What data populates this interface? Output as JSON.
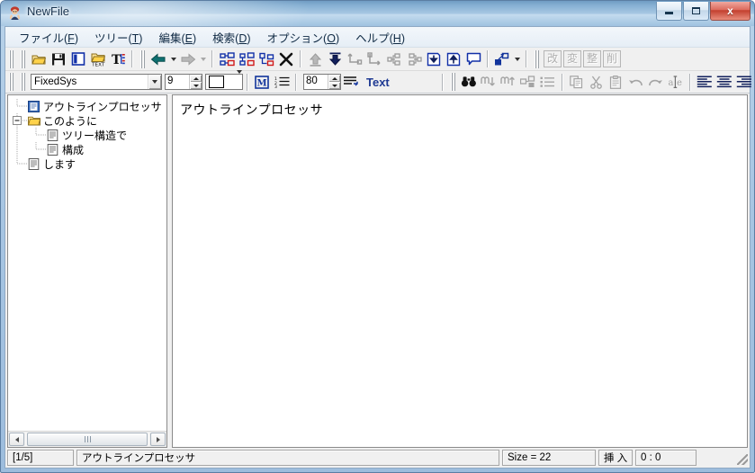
{
  "window": {
    "title": "NewFile",
    "icon": "app-character-icon",
    "buttons": {
      "minimize": "–",
      "maximize": "□",
      "close": "x"
    }
  },
  "menubar": {
    "items": [
      {
        "name": "file",
        "label": "ファイル(F)",
        "pre": "ファイル(",
        "key": "F",
        "post": ")"
      },
      {
        "name": "tree",
        "label": "ツリー(T)",
        "pre": "ツリー(",
        "key": "T",
        "post": ")"
      },
      {
        "name": "edit",
        "label": "編集(E)",
        "pre": "編集(",
        "key": "E",
        "post": ")"
      },
      {
        "name": "search",
        "label": "検索(D)",
        "pre": "検索(",
        "key": "D",
        "post": ")"
      },
      {
        "name": "options",
        "label": "オプション(O)",
        "pre": "オプション(",
        "key": "O",
        "post": ")"
      },
      {
        "name": "help",
        "label": "ヘルプ(H)",
        "pre": "ヘルプ(",
        "key": "H",
        "post": ")"
      }
    ]
  },
  "toolbar_main": {
    "groups": [
      {
        "items": [
          {
            "name": "open-file-icon",
            "state": "enabled"
          },
          {
            "name": "save-file-icon",
            "state": "enabled"
          },
          {
            "name": "window-panel-icon",
            "state": "enabled"
          },
          {
            "name": "open-text-icon",
            "state": "enabled"
          },
          {
            "name": "font-format-icon",
            "state": "enabled"
          }
        ]
      },
      {
        "items": [
          {
            "name": "navigate-back-icon",
            "state": "enabled",
            "dropdown": true
          },
          {
            "name": "navigate-forward-icon",
            "state": "disabled",
            "dropdown": true
          }
        ]
      },
      {
        "items": [
          {
            "name": "add-sibling-node-icon",
            "state": "enabled"
          },
          {
            "name": "add-child-node-icon",
            "state": "enabled"
          },
          {
            "name": "insert-node-icon",
            "state": "enabled"
          },
          {
            "name": "delete-node-icon",
            "state": "enabled"
          }
        ]
      },
      {
        "items": [
          {
            "name": "move-node-up-icon",
            "state": "disabled"
          },
          {
            "name": "move-node-down-icon",
            "state": "enabled"
          },
          {
            "name": "promote-node-icon",
            "state": "disabled"
          },
          {
            "name": "demote-node-icon",
            "state": "disabled"
          },
          {
            "name": "collapse-tree-icon",
            "state": "disabled"
          },
          {
            "name": "expand-tree-icon",
            "state": "disabled"
          },
          {
            "name": "import-node-icon",
            "state": "enabled"
          },
          {
            "name": "export-node-icon",
            "state": "enabled"
          },
          {
            "name": "comment-icon",
            "state": "enabled"
          }
        ]
      },
      {
        "items": [
          {
            "name": "node-properties-icon",
            "state": "enabled",
            "dropdown": true
          }
        ]
      }
    ],
    "kanji_buttons": [
      {
        "name": "kanji-button-kai",
        "label": "改",
        "state": "disabled"
      },
      {
        "name": "kanji-button-hen",
        "label": "変",
        "state": "disabled"
      },
      {
        "name": "kanji-button-sei",
        "label": "整",
        "state": "disabled"
      },
      {
        "name": "kanji-button-saku",
        "label": "削",
        "state": "disabled"
      }
    ]
  },
  "toolbar_format": {
    "font_name": "FixedSys",
    "font_size": "9",
    "color_swatch": "#ffffff",
    "buttons": [
      {
        "name": "bold-marker-icon",
        "label": "M",
        "state": "enabled"
      },
      {
        "name": "numbered-list-icon",
        "state": "enabled"
      }
    ],
    "wrap_width": "80",
    "indent_icon": "indent-wrap-icon",
    "text_label": "Text",
    "right_items": [
      {
        "name": "find-icon",
        "state": "enabled"
      },
      {
        "name": "find-next-icon",
        "state": "disabled"
      },
      {
        "name": "find-previous-icon",
        "state": "disabled"
      },
      {
        "name": "replace-icon",
        "state": "disabled"
      },
      {
        "name": "list-view-icon",
        "state": "disabled"
      },
      {
        "name": "copy-icon",
        "state": "disabled"
      },
      {
        "name": "cut-icon",
        "state": "disabled"
      },
      {
        "name": "paste-icon",
        "state": "disabled"
      },
      {
        "name": "undo-icon",
        "state": "disabled"
      },
      {
        "name": "redo-icon",
        "state": "disabled"
      },
      {
        "name": "spellcheck-icon",
        "state": "disabled"
      },
      {
        "name": "align-left-icon",
        "state": "enabled"
      },
      {
        "name": "align-center-icon",
        "state": "enabled"
      },
      {
        "name": "align-right-icon",
        "state": "enabled"
      }
    ]
  },
  "tree": {
    "nodes": [
      {
        "label": "アウトラインプロセッサ",
        "depth": 0,
        "icon": "document-icon",
        "selected": true,
        "expander": "none"
      },
      {
        "label": "このように",
        "depth": 0,
        "icon": "folder-icon",
        "selected": false,
        "expander": "minus"
      },
      {
        "label": "ツリー構造で",
        "depth": 1,
        "icon": "document-icon",
        "selected": false,
        "expander": "none"
      },
      {
        "label": "構成",
        "depth": 1,
        "icon": "document-icon",
        "selected": false,
        "expander": "none"
      },
      {
        "label": "します",
        "depth": 0,
        "icon": "document-icon",
        "selected": false,
        "expander": "none"
      }
    ],
    "hscroll": {
      "left_arrow": "scroll-left-icon",
      "right_arrow": "scroll-right-icon"
    }
  },
  "editor": {
    "content": "アウトラインプロセッサ"
  },
  "statusbar": {
    "page": "[1/5]",
    "path": "アウトラインプロセッサ",
    "size": "Size = 22",
    "mode": "挿 入",
    "position": "0 : 0"
  },
  "colors": {
    "accent_blue": "#1f3a93",
    "title_text": "#16314d",
    "icon_navy": "#1c3a8c",
    "icon_teal": "#0f7070",
    "icon_yellow": "#ffd24a",
    "icon_red": "#d01a1a"
  }
}
